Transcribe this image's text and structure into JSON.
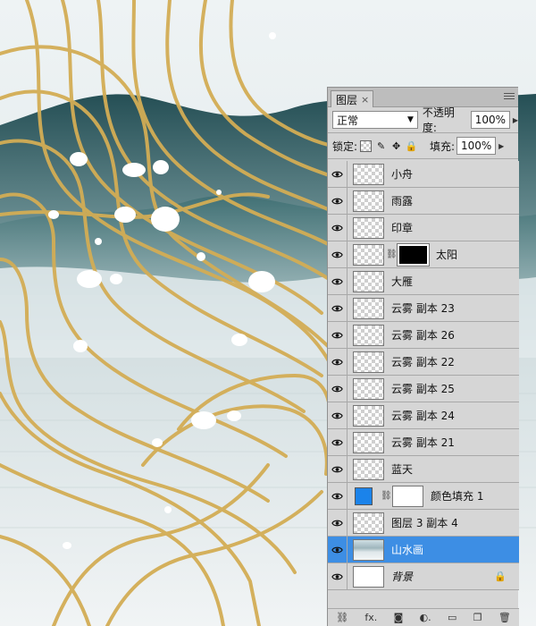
{
  "panel": {
    "tab_label": "图层",
    "tab_close": "×",
    "blend_mode": "正常",
    "opacity_label": "不透明度:",
    "opacity_value": "100%",
    "lock_label": "锁定:",
    "fill_label": "填充:",
    "fill_value": "100%",
    "layers": [
      {
        "name": "小舟",
        "thumb": "transparent"
      },
      {
        "name": "雨露",
        "thumb": "transparent"
      },
      {
        "name": "印章",
        "thumb": "transparent"
      },
      {
        "name": "太阳",
        "thumb": "transparent",
        "mask": "black",
        "linked": true
      },
      {
        "name": "大雁",
        "thumb": "transparent"
      },
      {
        "name": "云雾 副本 23",
        "thumb": "transparent"
      },
      {
        "name": "云雾 副本 26",
        "thumb": "transparent"
      },
      {
        "name": "云雾 副本 22",
        "thumb": "transparent"
      },
      {
        "name": "云雾 副本 25",
        "thumb": "transparent"
      },
      {
        "name": "云雾 副本 24",
        "thumb": "transparent"
      },
      {
        "name": "云雾 副本 21",
        "thumb": "transparent"
      },
      {
        "name": "蓝天",
        "thumb": "transparent"
      },
      {
        "name": "颜色填充 1",
        "thumb": "fill",
        "fill_color": "#1b83ea",
        "mask": "white",
        "linked": true
      },
      {
        "name": "图层 3 副本 4",
        "thumb": "transparent"
      },
      {
        "name": "山水画",
        "thumb": "scene",
        "selected": true
      },
      {
        "name": "背景",
        "thumb": "white",
        "locked": true,
        "italic": true
      }
    ],
    "footer_icons": [
      "link-icon",
      "fx-icon",
      "mask-icon",
      "adjustment-icon",
      "folder-icon",
      "new-layer-icon",
      "trash-icon"
    ],
    "footer_glyphs": [
      "⛓",
      "fx.",
      "◙",
      "◐.",
      "▭",
      "❐",
      "🗑"
    ]
  },
  "colors": {
    "selected_row": "#3d8ee4",
    "panel_bg": "#d6d6d6",
    "gold_line": "#d9b45a",
    "mountain_dark": "#2f5b60"
  }
}
